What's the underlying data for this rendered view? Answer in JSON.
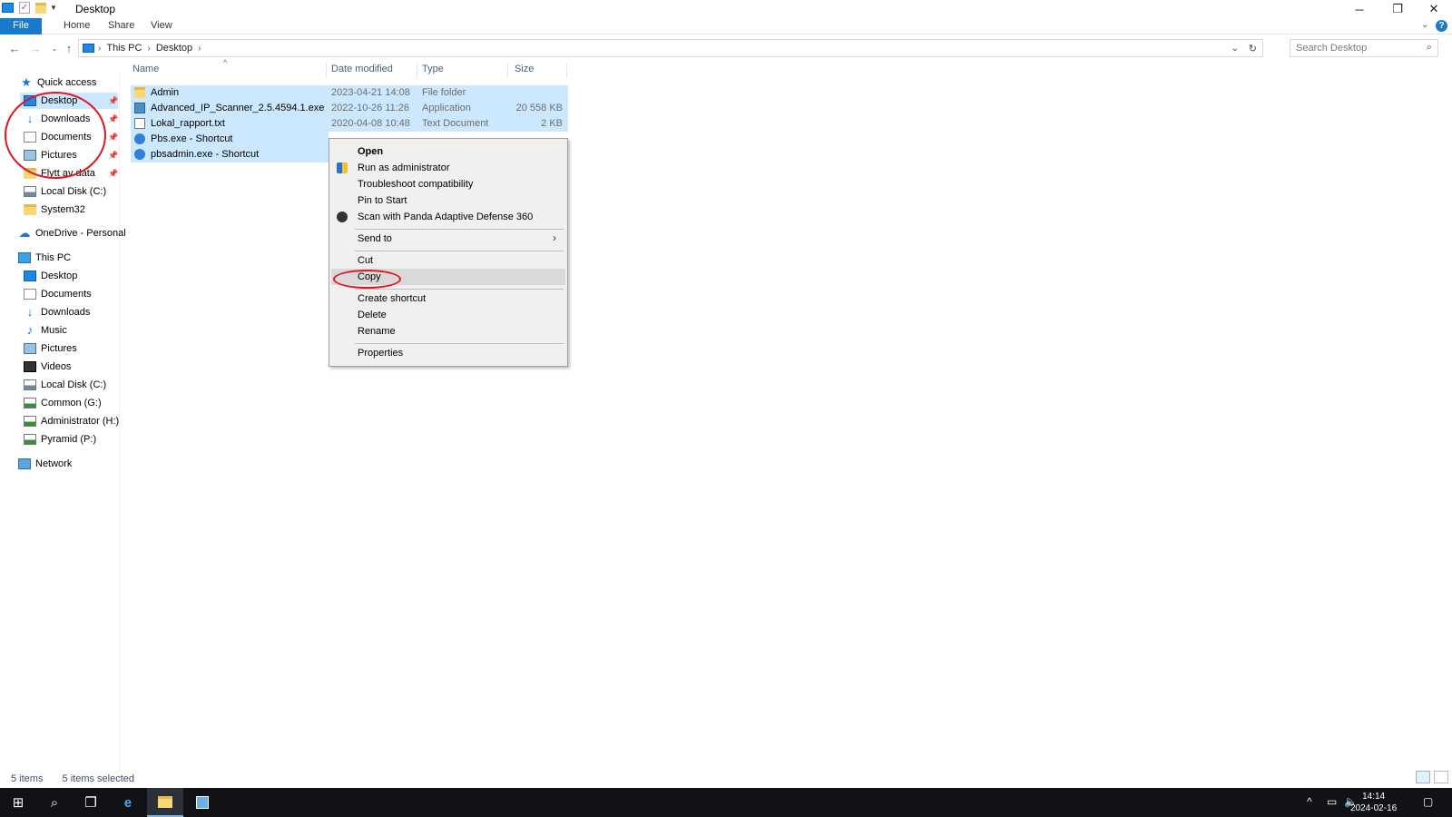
{
  "window": {
    "title": "Desktop"
  },
  "ribbon": {
    "tabs": [
      "File",
      "Home",
      "Share",
      "View"
    ]
  },
  "address": {
    "crumbs": [
      "This PC",
      "Desktop"
    ],
    "search_placeholder": "Search Desktop"
  },
  "navpane": {
    "quick_access": "Quick access",
    "quick_items": [
      "Desktop",
      "Downloads",
      "Documents",
      "Pictures",
      "Flytt av data",
      "Local Disk (C:)",
      "System32"
    ],
    "onedrive": "OneDrive - Personal",
    "this_pc": "This PC",
    "pc_items": [
      "Desktop",
      "Documents",
      "Downloads",
      "Music",
      "Pictures",
      "Videos",
      "Local Disk (C:)",
      "Common (G:)",
      "Administrator (H:)",
      "Pyramid (P:)"
    ],
    "network": "Network"
  },
  "columns": {
    "name": "Name",
    "date": "Date modified",
    "type": "Type",
    "size": "Size"
  },
  "files": [
    {
      "name": "Admin",
      "date": "2023-04-21 14:08",
      "type": "File folder",
      "size": "",
      "icon": "folder-icon"
    },
    {
      "name": "Advanced_IP_Scanner_2.5.4594.1.exe",
      "date": "2022-10-26 11:26",
      "type": "Application",
      "size": "20 558 KB",
      "icon": "app-icon"
    },
    {
      "name": "Lokal_rapport.txt",
      "date": "2020-04-08 10:48",
      "type": "Text Document",
      "size": "2 KB",
      "icon": "text-file-icon"
    },
    {
      "name": "Pbs.exe - Shortcut",
      "date": "",
      "type": "",
      "size": "",
      "icon": "shortcut-icon"
    },
    {
      "name": "pbsadmin.exe - Shortcut",
      "date": "",
      "type": "",
      "size": "",
      "icon": "shortcut-icon"
    }
  ],
  "context_menu": {
    "open": "Open",
    "run_as_admin": "Run as administrator",
    "troubleshoot": "Troubleshoot compatibility",
    "pin_start": "Pin to Start",
    "scan": "Scan with Panda Adaptive Defense 360",
    "send_to": "Send to",
    "cut": "Cut",
    "copy": "Copy",
    "create_shortcut": "Create shortcut",
    "delete": "Delete",
    "rename": "Rename",
    "properties": "Properties"
  },
  "status": {
    "items": "5 items",
    "selected": "5 items selected"
  },
  "taskbar": {
    "time": "14:14",
    "date": "2024-02-16"
  },
  "colors": {
    "selection": "#cce8ff",
    "accent": "#1979ca",
    "annotation": "#e0161f"
  }
}
